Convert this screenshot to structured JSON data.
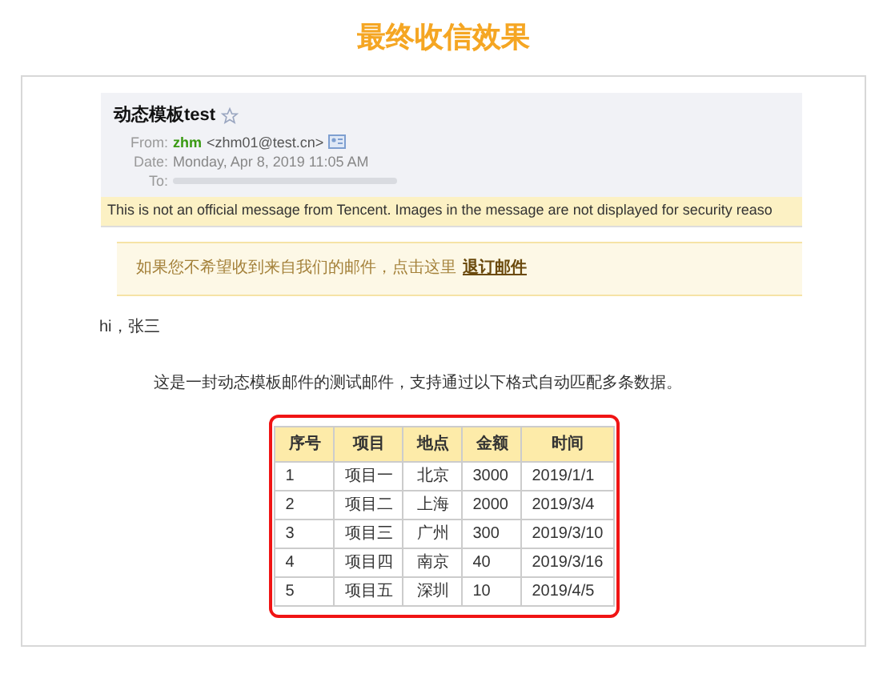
{
  "heading": "最终收信效果",
  "email": {
    "subject": "动态模板test",
    "starred": false,
    "from_label": "From:",
    "from_name": "zhm",
    "from_address": "<zhm01@test.cn>",
    "date_label": "Date:",
    "date": "Monday, Apr 8, 2019 11:05 AM",
    "to_label": "To:",
    "security_notice": "This is not an official message from Tencent. Images in the message are not displayed for security reaso",
    "unsubscribe": {
      "text": "如果您不希望收到来自我们的邮件，点击这里",
      "link": "退订邮件"
    },
    "greeting": "hi，张三",
    "body": "这是一封动态模板邮件的测试邮件，支持通过以下格式自动匹配多条数据。",
    "table": {
      "columns": [
        "序号",
        "项目",
        "地点",
        "金额",
        "时间"
      ],
      "rows": [
        [
          "1",
          "项目一",
          "北京",
          "3000",
          "2019/1/1"
        ],
        [
          "2",
          "项目二",
          "上海",
          "2000",
          "2019/3/4"
        ],
        [
          "3",
          "项目三",
          "广州",
          "300",
          "2019/3/10"
        ],
        [
          "4",
          "项目四",
          "南京",
          "40",
          "2019/3/16"
        ],
        [
          "5",
          "项目五",
          "深圳",
          "10",
          "2019/4/5"
        ]
      ]
    }
  }
}
